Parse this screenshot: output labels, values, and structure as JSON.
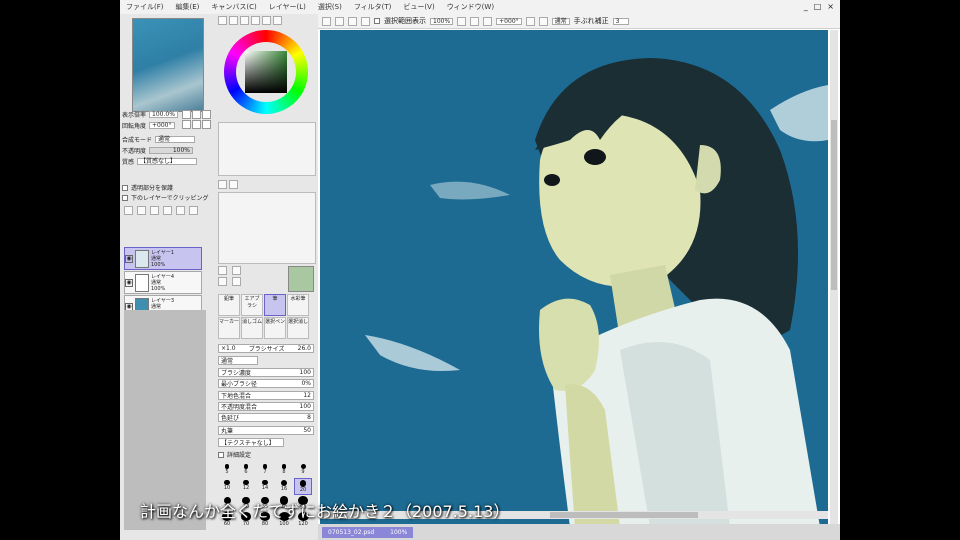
{
  "menu": [
    "ファイル(F)",
    "編集(E)",
    "キャンバス(C)",
    "レイヤー(L)",
    "選択(S)",
    "フィルタ(T)",
    "ビュー(V)",
    "ウィンドウ(W)"
  ],
  "window_controls": [
    "_",
    "□",
    "×"
  ],
  "canvas_toolbar": {
    "checkbox_label": "選択範囲表示",
    "zoom": "100%",
    "rotation": "+000°",
    "stabilizer_label": "手ぶれ補正",
    "stabilizer_value": "3",
    "view_btn": "通常"
  },
  "left_panel": {
    "zoom_label": "表示倍率",
    "zoom_value": "100.0%",
    "rotation_label": "回転角度",
    "rotation_value": "+000°",
    "blend_label": "合成モード",
    "blend_value": "通常",
    "opacity_label": "不透明度",
    "opacity_value": "100%",
    "group_label": "質感",
    "group_value": "【質感なし】",
    "protect_label": "透明部分を保護",
    "clip_label": "下のレイヤーでクリッピング",
    "layers": [
      {
        "name": "レイヤー1",
        "mode": "通常",
        "opacity": "100%",
        "selected": true
      },
      {
        "name": "レイヤー4",
        "mode": "通常",
        "opacity": "100%",
        "selected": false
      },
      {
        "name": "レイヤー3",
        "mode": "通常",
        "opacity": "100%",
        "selected": false
      }
    ]
  },
  "tools": [
    "鉛筆",
    "エアブラシ",
    "筆",
    "水彩筆",
    "マーカー",
    "消しゴム",
    "選択ペン",
    "選択消し"
  ],
  "brush": {
    "size_mult": "×1.0",
    "size_label": "ブラシサイズ",
    "size_value": "26.0",
    "mode": "通常",
    "density_label": "ブラシ濃度",
    "density_value": "100",
    "min_size_label": "最小ブラシ径",
    "min_size_value": "0%",
    "blend_label": "下地色混合",
    "blend_value": "12",
    "water_label": "不透明度混合",
    "water_value": "100",
    "ext_label": "色延び",
    "ext_value": "8",
    "shape": "丸筆",
    "shape_value": "50",
    "texture": "【テクスチャなし】",
    "advanced": "詳細設定",
    "dot_sizes": [
      "5",
      "6",
      "7",
      "8",
      "9",
      "10",
      "12",
      "14",
      "16",
      "20",
      "25",
      "30",
      "35",
      "40",
      "50",
      "60",
      "70",
      "80",
      "100",
      "120"
    ]
  },
  "document_tab": {
    "name": "070513_02.psd",
    "zoom": "100%"
  },
  "subtitle": "計画なんか全くたてずにお絵かき２（2007.5.13）"
}
